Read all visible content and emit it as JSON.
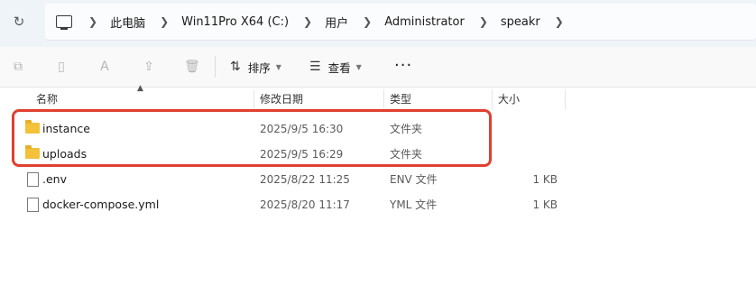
{
  "breadcrumb": [
    "此电脑",
    "Win11Pro X64 (C:)",
    "用户",
    "Administrator",
    "speakr"
  ],
  "toolbar": {
    "sort_label": "排序",
    "view_label": "查看",
    "more_label": "···"
  },
  "columns": {
    "name": "名称",
    "date": "修改日期",
    "type": "类型",
    "size": "大小"
  },
  "files": [
    {
      "name": "instance",
      "date": "2025/9/5 16:30",
      "type": "文件夹",
      "size": "",
      "icon": "folder-icon"
    },
    {
      "name": "uploads",
      "date": "2025/9/5 16:29",
      "type": "文件夹",
      "size": "",
      "icon": "folder-icon"
    },
    {
      "name": ".env",
      "date": "2025/8/22 11:25",
      "type": "ENV 文件",
      "size": "1 KB",
      "icon": "file-icon"
    },
    {
      "name": "docker-compose.yml",
      "date": "2025/8/20 11:17",
      "type": "YML 文件",
      "size": "1 KB",
      "icon": "file-icon"
    }
  ],
  "highlight_color": "#e0402f"
}
